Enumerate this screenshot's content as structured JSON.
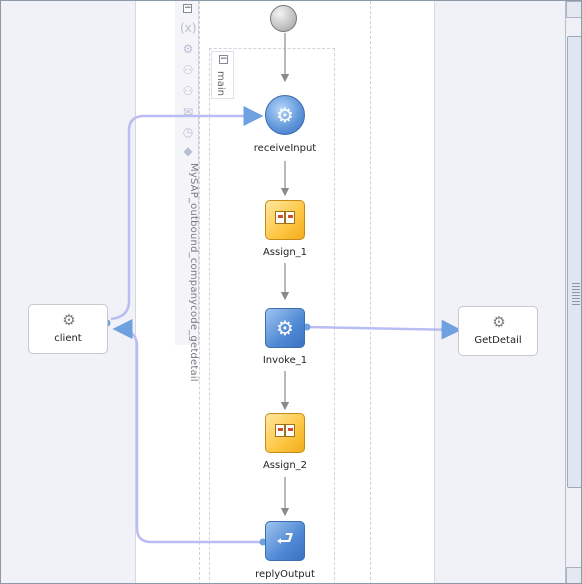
{
  "process": {
    "scope_name": "MySAP_outbound_companycode_getdetail",
    "sequence_name": "main"
  },
  "activities": [
    {
      "id": "receiveInput",
      "label": "receiveInput",
      "kind": "receive",
      "icon": "gear-icon"
    },
    {
      "id": "assign1",
      "label": "Assign_1",
      "kind": "assign",
      "icon": "assign-icon"
    },
    {
      "id": "invoke1",
      "label": "Invoke_1",
      "kind": "invoke",
      "icon": "gear-icon"
    },
    {
      "id": "assign2",
      "label": "Assign_2",
      "kind": "assign",
      "icon": "assign-icon"
    },
    {
      "id": "replyOutput",
      "label": "replyOutput",
      "kind": "reply",
      "icon": "reply-icon"
    }
  ],
  "partner_links": {
    "left": {
      "label": "client",
      "icon": "gear-icon"
    },
    "right": {
      "label": "GetDetail",
      "icon": "gear-icon"
    }
  },
  "scope_tools": [
    "variables-icon",
    "correlation-icon",
    "add-partner-icon",
    "add-handler-icon",
    "add-event-icon",
    "timer-icon",
    "add-flow-icon"
  ],
  "colors": {
    "swimlane": "#f1f1f8",
    "wire": "#b9bdf3",
    "arrow": "#8a8a8a",
    "activity_blue": "#4f88d4",
    "activity_yellow": "#fdc542"
  }
}
